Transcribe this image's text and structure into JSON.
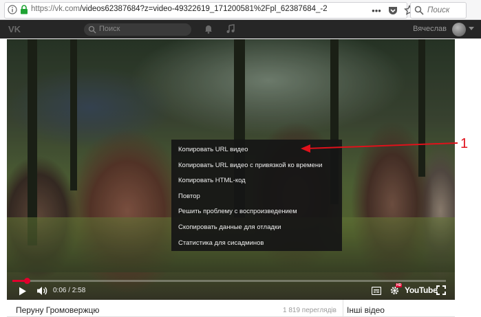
{
  "browser": {
    "url_host": "https://vk.com",
    "url_path": "/videos62387684?z=video-49322619_171200581%2Fpl_62387684_-2",
    "search_placeholder": "Поиск"
  },
  "vk_header": {
    "search_placeholder": "Поиск",
    "user_name": "Вячеслав"
  },
  "context_menu": {
    "items": [
      "Копировать URL видео",
      "Копировать URL видео с привязкой ко времени",
      "Копировать HTML-код",
      "Повтор",
      "Решить проблему с воспроизведением",
      "Скопировать данные для отладки",
      "Статистика для сисадминов"
    ]
  },
  "annotation": {
    "label": "1",
    "color": "#e0111b"
  },
  "player": {
    "current_time": "0:06",
    "duration": "2:58",
    "time_display": "0:06 / 2:58",
    "progress_fraction": 0.034,
    "hd_badge": "HD",
    "brand": "YouTube",
    "accent_color": "#e1002d"
  },
  "video_info": {
    "title": "Перуну Громовержцю",
    "views": "1 819 переглядів",
    "sidebar_title": "Інші відео"
  }
}
